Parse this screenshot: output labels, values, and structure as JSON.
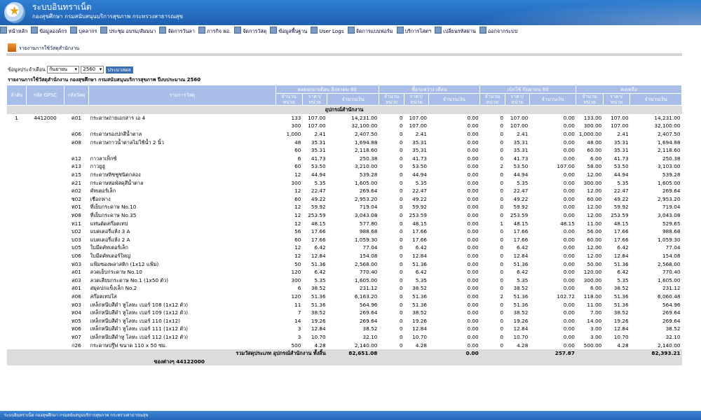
{
  "header": {
    "title": "ระบบอินทราเน็ต",
    "subtitle": "กองสุขศึกษา กรมสนับสนุนบริการสุขภาพ กระทรวงสาธารณสุข"
  },
  "menu": [
    "หน้าหลัก",
    "ข้อมูลองค์กร",
    "บุคลากร",
    "ประชุม อบรม/สัมมนา",
    "จัดการวันลา",
    "ภารกิจ ผอ.",
    "จัดการวัสดุ",
    "ข้อมูลพื้นฐาน",
    "User Logs",
    "จัดการแบบฟอร์ม",
    "บริการโสตฯ",
    "เปลี่ยนรหัสผ่าน",
    "ออกจากระบบ"
  ],
  "page_title": "รายงานการใช้วัสดุสำนักงาน",
  "filter": {
    "label": "ข้อมูลประจำเดือน",
    "month": "กันยายน",
    "year": "2560",
    "button": "ประมวลผล"
  },
  "report_title": "รายงานการใช้วัสดุสำนักงาน กองสุขศึกษา กรมสนับสนุนบริการสุขภาพ ปีงบประมาณ 2560",
  "table": {
    "h_no": "ลำดับ",
    "h_gpsc": "รหัส GPSC",
    "h_code": "รหัสวัสดุ",
    "h_item": "รายการวัสดุ",
    "g1": "ยอดยกมาเดือน สิงหาคม 60",
    "g2": "ซื้อระหว่าง เดือน",
    "g3": "เบิกใช้ กันยายน 60",
    "g4": "คงเหลือ",
    "s_qty": "จำนวน หน่วย",
    "s_price": "ราคา/ หน่วย",
    "s_amt": "จำนวนเงิน",
    "category": "อุปกรณ์สำนักงาน",
    "rows": [
      [
        "1",
        "4412000",
        "ค01",
        "กระดาษถ่ายเอกสาร เอ 4",
        "133",
        "107.00",
        "14,231.00",
        "0",
        "107.00",
        "0.00",
        "0",
        "107.00",
        "0.00",
        "133.00",
        "107.00",
        "14,231.00"
      ],
      [
        "",
        "",
        "",
        "",
        "300",
        "107.00",
        "32,100.00",
        "0",
        "107.00",
        "0.00",
        "0",
        "107.00",
        "0.00",
        "300.00",
        "107.00",
        "32,100.00"
      ],
      [
        "",
        "",
        "ค06",
        "กระดาษรองปกสีน้ำตาล",
        "1,000",
        "2.41",
        "2,407.50",
        "0",
        "2.41",
        "0.00",
        "0",
        "2.41",
        "0.00",
        "1,000.00",
        "2.41",
        "2,407.50"
      ],
      [
        "",
        "",
        "ค08",
        "กระดาษกาวน้ำตาลไม่ใช้น้ำ 2 นิ้ว",
        "48",
        "35.31",
        "1,694.88",
        "0",
        "35.31",
        "0.00",
        "0",
        "35.31",
        "0.00",
        "48.00",
        "35.31",
        "1,694.88"
      ],
      [
        "",
        "",
        "",
        "",
        "60",
        "35.31",
        "2,118.60",
        "0",
        "35.31",
        "0.00",
        "0",
        "35.31",
        "0.00",
        "60.00",
        "35.31",
        "2,118.60"
      ],
      [
        "",
        "",
        "ค12",
        "กาวลาเท็กซ์",
        "6",
        "41.73",
        "250.38",
        "0",
        "41.73",
        "0.00",
        "0",
        "41.73",
        "0.00",
        "6.00",
        "41.73",
        "250.38"
      ],
      [
        "",
        "",
        "ค13",
        "กาวยูฮู",
        "60",
        "53.50",
        "3,210.00",
        "0",
        "53.50",
        "0.00",
        "2",
        "53.50",
        "107.00",
        "58.00",
        "53.50",
        "3,103.00"
      ],
      [
        "",
        "",
        "ค15",
        "กระดาษทิชชูชนิดกล่อง",
        "12",
        "44.94",
        "539.28",
        "0",
        "44.94",
        "0.00",
        "0",
        "44.94",
        "0.00",
        "12.00",
        "44.94",
        "539.28"
      ],
      [
        "",
        "",
        "ค21",
        "กระดาษห่อพัสดุสีน้ำตาล",
        "300",
        "5.35",
        "1,605.00",
        "0",
        "5.35",
        "0.00",
        "0",
        "5.35",
        "0.00",
        "300.00",
        "5.35",
        "1,605.00"
      ],
      [
        "",
        "",
        "ค02",
        "คัทเตอร์เล็ก",
        "12",
        "22.47",
        "269.64",
        "0",
        "22.47",
        "0.00",
        "0",
        "22.47",
        "0.00",
        "12.00",
        "22.47",
        "269.64"
      ],
      [
        "",
        "",
        "ช02",
        "เชือกฟาง",
        "60",
        "49.22",
        "2,953.20",
        "0",
        "49.22",
        "0.00",
        "0",
        "49.22",
        "0.00",
        "60.00",
        "49.22",
        "2,953.20"
      ],
      [
        "",
        "",
        "ท01",
        "ที่เย็บกระดาษ No.10",
        "12",
        "59.92",
        "719.04",
        "0",
        "59.92",
        "0.00",
        "0",
        "59.92",
        "0.00",
        "12.00",
        "59.92",
        "719.04"
      ],
      [
        "",
        "",
        "ท08",
        "ที่เย็บกระดาษ No.35",
        "12",
        "253.59",
        "3,043.08",
        "0",
        "253.59",
        "0.00",
        "0",
        "253.59",
        "0.00",
        "12.00",
        "253.59",
        "3,043.08"
      ],
      [
        "",
        "",
        "ท11",
        "แท่นตัดสก๊อตเทป",
        "12",
        "48.15",
        "577.80",
        "0",
        "48.15",
        "0.00",
        "1",
        "48.15",
        "48.15",
        "11.00",
        "48.15",
        "529.65"
      ],
      [
        "",
        "",
        "บ02",
        "แบตเตอรี่แห้ง 3 A",
        "56",
        "17.66",
        "988.68",
        "0",
        "17.66",
        "0.00",
        "0",
        "17.66",
        "0.00",
        "56.00",
        "17.66",
        "988.68"
      ],
      [
        "",
        "",
        "บ03",
        "แบตเตอรี่แห้ง 2 A",
        "60",
        "17.66",
        "1,059.30",
        "0",
        "17.66",
        "0.00",
        "0",
        "17.66",
        "0.00",
        "60.00",
        "17.66",
        "1,059.30"
      ],
      [
        "",
        "",
        "บ05",
        "ใบมีดคัทเตอร์เล็ก",
        "12",
        "6.42",
        "77.04",
        "0",
        "6.42",
        "0.00",
        "0",
        "6.42",
        "0.00",
        "12.00",
        "6.42",
        "77.04"
      ],
      [
        "",
        "",
        "บ06",
        "ใบมีดคัทเตอร์ใหญ่",
        "12",
        "12.84",
        "154.08",
        "0",
        "12.84",
        "0.00",
        "0",
        "12.84",
        "0.00",
        "12.00",
        "12.84",
        "154.08"
      ],
      [
        "",
        "",
        "ฟ03",
        "แฟ้มซองพลาสติก (1x12 แฟ้ม)",
        "50",
        "51.36",
        "2,568.00",
        "0",
        "51.36",
        "0.00",
        "0",
        "51.36",
        "0.00",
        "50.00",
        "51.36",
        "2,568.00"
      ],
      [
        "",
        "",
        "ล01",
        "ลวดเย็บกระดาษ No.10",
        "120",
        "6.42",
        "770.40",
        "0",
        "6.42",
        "0.00",
        "0",
        "6.42",
        "0.00",
        "120.00",
        "6.42",
        "770.40"
      ],
      [
        "",
        "",
        "ล03",
        "ลวดเสียบกระดาษ No.1 (1x50 ตัว)",
        "300",
        "5.35",
        "1,605.00",
        "0",
        "5.35",
        "0.00",
        "0",
        "5.35",
        "0.00",
        "300.00",
        "5.35",
        "1,605.00"
      ],
      [
        "",
        "",
        "ส01",
        "สมุดปกแข็งเล็ก No.2",
        "6",
        "38.52",
        "231.12",
        "0",
        "38.52",
        "0.00",
        "0",
        "38.52",
        "0.00",
        "6.00",
        "38.52",
        "231.12"
      ],
      [
        "",
        "",
        "ส06",
        "สก๊อตเทปใส",
        "120",
        "51.36",
        "6,163.20",
        "0",
        "51.36",
        "0.00",
        "2",
        "51.36",
        "102.72",
        "118.00",
        "51.36",
        "6,060.48"
      ],
      [
        "",
        "",
        "ห03",
        "เหล็กหนีบสีดำ หูโลหะ เบอร์ 108 (1x12 ตัว)",
        "11",
        "51.36",
        "564.96",
        "0",
        "51.36",
        "0.00",
        "0",
        "51.36",
        "0.00",
        "11.00",
        "51.36",
        "564.96"
      ],
      [
        "",
        "",
        "ห04",
        "เหล็กหนีบสีดำ หูโลหะ เบอร์ 109 (1x12 ตัว)",
        "7",
        "38.52",
        "269.64",
        "0",
        "38.52",
        "0.00",
        "0",
        "38.52",
        "0.00",
        "7.00",
        "38.52",
        "269.64"
      ],
      [
        "",
        "",
        "ห05",
        "เหล็กหนีบสีดำ หูโลหะ เบอร์ 110 (1x12)",
        "14",
        "19.26",
        "269.64",
        "0",
        "19.26",
        "0.00",
        "0",
        "19.26",
        "0.00",
        "14.00",
        "19.26",
        "269.64"
      ],
      [
        "",
        "",
        "ห06",
        "เหล็กหนีบสีดำ หูโลหะ เบอร์ 111 (1x12 ตัว)",
        "3",
        "12.84",
        "38.52",
        "0",
        "12.84",
        "0.00",
        "0",
        "12.84",
        "0.00",
        "3.00",
        "12.84",
        "38.52"
      ],
      [
        "",
        "",
        "ห07",
        "เหล็กหนีบสีดำหู โลหะ เบอร์ 112 (1x12 ตัว)",
        "3",
        "10.70",
        "32.10",
        "0",
        "10.70",
        "0.00",
        "0",
        "10.70",
        "0.00",
        "3.00",
        "10.70",
        "32.10"
      ],
      [
        "",
        "",
        "ก26",
        "กระดาษปรู๊ฟ ขนาด 110 x 50 ซม.",
        "500",
        "4.28",
        "2,140.00",
        "0",
        "4.28",
        "0.00",
        "0",
        "4.28",
        "0.00",
        "500.00",
        "4.28",
        "2,140.00"
      ]
    ],
    "total_label": "รวมวัสดุประเภท อุปกรณ์สำนักงาน ทั้งสิ้น",
    "total_carry": "82,651.08",
    "total_buy": "0.00",
    "total_use": "257.87",
    "total_remain": "82,393.21",
    "group_label": "ของต่างๆ 44122000"
  },
  "footer": "ระบบอินทราเน็ต กองสุขศึกษา กรมสนับสนุนบริการสุขภาพ กระทรวงสาธารณสุข"
}
